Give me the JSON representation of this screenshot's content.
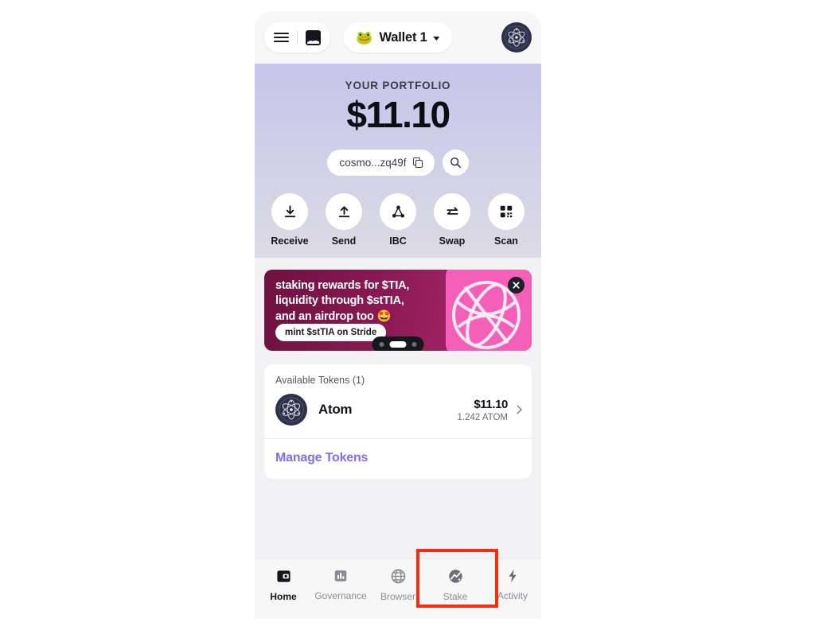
{
  "top_bar": {
    "menu_icon": "hamburger-menu-icon",
    "gallery_icon": "image-icon",
    "wallet": {
      "emoji": "🐸",
      "name": "Wallet 1",
      "caret": "chevron-down-icon"
    },
    "avatar_icon": "cosmos-atom-avatar"
  },
  "hero": {
    "portfolio_label": "YOUR PORTFOLIO",
    "portfolio_value": "$11.10",
    "address": "cosmo...zq49f",
    "copy_icon": "copy-icon",
    "search_icon": "search-icon",
    "gradient_top": "#c7c5e9",
    "gradient_bottom": "#dcdbe4"
  },
  "actions": [
    {
      "label": "Receive",
      "icon": "download-arrow-icon"
    },
    {
      "label": "Send",
      "icon": "upload-arrow-icon"
    },
    {
      "label": "IBC",
      "icon": "ibc-node-graph-icon"
    },
    {
      "label": "Swap",
      "icon": "swap-arrows-icon"
    },
    {
      "label": "Scan",
      "icon": "qr-scan-icon"
    }
  ],
  "banner": {
    "line1": "staking rewards for $TIA,",
    "line2": "liquidity through $stTIA,",
    "line3": "and an airdrop too 🤩",
    "cta_label": "mint $stTIA on Stride",
    "close_icon": "close-icon",
    "accent_color": "#f45fb8",
    "background_start": "#6d1140",
    "background_end": "#c2297c",
    "carousel": {
      "total": 3,
      "active_index": 1
    }
  },
  "token_card": {
    "title": "Available Tokens (1)",
    "tokens": [
      {
        "name": "Atom",
        "fiat_value": "$11.10",
        "amount": "1.242 ATOM",
        "icon": "cosmos-atom-icon"
      }
    ],
    "manage_label": "Manage Tokens",
    "manage_color": "#7c6ff0"
  },
  "bottom_nav": {
    "items": [
      {
        "label": "Home",
        "icon": "wallet-icon",
        "active": true
      },
      {
        "label": "Governance",
        "icon": "bar-chart-icon",
        "active": false
      },
      {
        "label": "Browser",
        "icon": "globe-icon",
        "active": false
      },
      {
        "label": "Stake",
        "icon": "stake-chart-icon",
        "active": false
      },
      {
        "label": "Activity",
        "icon": "lightning-bolt-icon",
        "active": false
      }
    ]
  },
  "annotation": {
    "target": "Stake",
    "color": "#fa2c10"
  }
}
